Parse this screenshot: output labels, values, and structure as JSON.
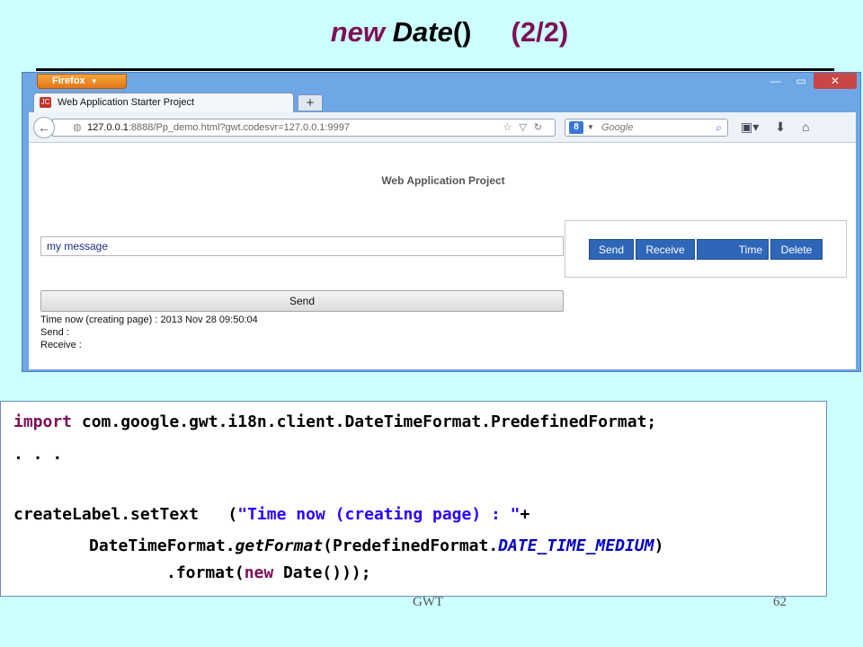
{
  "slide": {
    "title_new": "new",
    "title_date": "Date",
    "title_parens": "()",
    "title_counter": "(2/2)",
    "footer_label": "GWT",
    "page_number": "62"
  },
  "browser": {
    "firefox_button": "Firefox",
    "tab_title": "Web Application Starter Project",
    "url_host": "127.0.0.1",
    "url_rest": ":8888/Pp_demo.html?gwt.codesvr=127.0.0.1:9997",
    "search_placeholder": "Google",
    "icons": [
      "back-icon",
      "globe-icon",
      "star-icon",
      "dropdown-icon",
      "reload-icon",
      "google-icon",
      "search-icon",
      "bookmarks-icon",
      "download-icon",
      "home-icon"
    ]
  },
  "app": {
    "title": "Web Application Project",
    "message_value": "my message",
    "buttons": {
      "send": "Send",
      "receive": "Receive",
      "time": "Time",
      "delete": "Delete"
    },
    "send_wide_label": "Send",
    "status": {
      "time_now": "Time now (creating page) : 2013 Nov 28 09:50:04",
      "send": "Send :",
      "receive": "Receive :"
    }
  },
  "code": {
    "l1_kw": "import",
    "l1_rest": " com.google.gwt.i18n.client.DateTimeFormat.PredefinedFormat;",
    "l2": ". . .",
    "l3_a": "createLabel.setText   (",
    "l3_str": "\"Time now (creating page) : \"",
    "l3_b": "+",
    "l4_a": "DateTimeFormat.",
    "l4_method": "getFormat",
    "l4_b": "(PredefinedFormat.",
    "l4_field": "DATE_TIME_MEDIUM",
    "l4_c": ")",
    "l5_a": ".format(",
    "l5_kw": "new",
    "l5_b": " Date()));"
  },
  "colors": {
    "background": "#ccffff",
    "keyword": "#7f0f55",
    "string": "#2a00ff",
    "button_blue": "#2e66b8"
  }
}
